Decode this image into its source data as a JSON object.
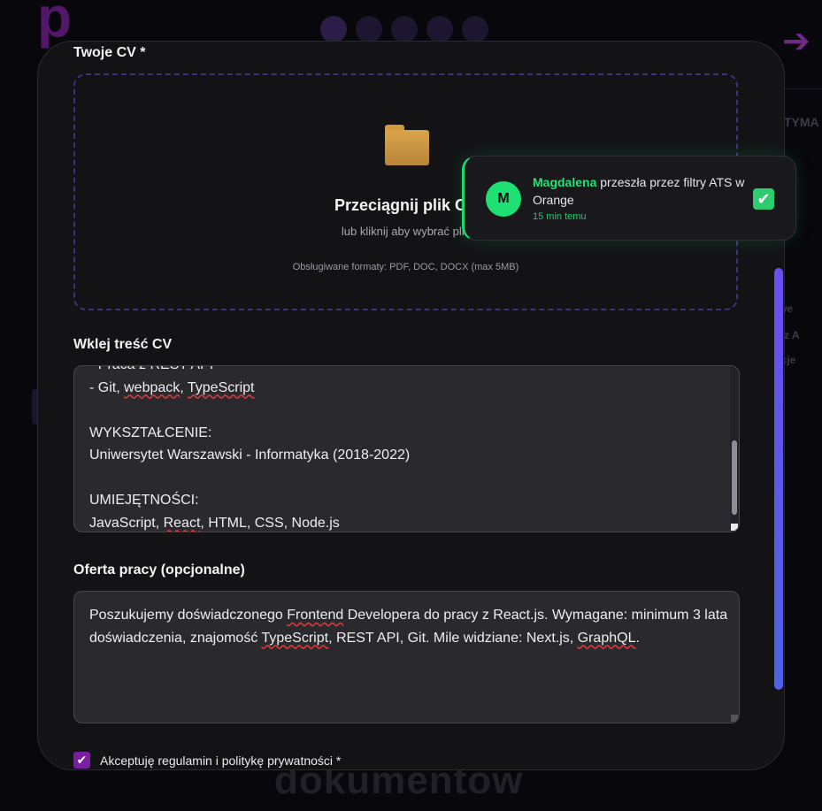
{
  "background": {
    "logo_letter": "p",
    "bottom_text": "dokumentow",
    "right_fragments": [
      "TYMA",
      "we",
      "y z A",
      "kcje"
    ]
  },
  "cv_upload": {
    "label": "Twoje CV *",
    "dropzone_title": "Przeciągnij plik CV",
    "dropzone_subtitle": "lub kliknij aby wybrać plik",
    "formats": "Obsługiwane formaty: PDF, DOC, DOCX (max 5MB)"
  },
  "paste_cv": {
    "label": "Wklej treść CV",
    "lines": [
      "- Praca z REST API",
      "- Git, webpack, TypeScript",
      "",
      "WYKSZTAŁCENIE:",
      "Uniwersytet Warszawski - Informatyka (2018-2022)",
      "",
      "UMIEJĘTNOŚCI:",
      "JavaScript, React, HTML, CSS, Node.js"
    ]
  },
  "job_offer": {
    "label": "Oferta pracy (opcjonalne)",
    "value": "Poszukujemy doświadczonego Frontend Developera do pracy z React.js. Wymagane: minimum 3 lata doświadczenia, znajomość TypeScript, REST API, Git. Mile widziane: Next.js, GraphQL."
  },
  "terms": {
    "label": "Akceptuję regulamin i politykę prywatności *",
    "checked": true
  },
  "toast": {
    "avatar_letter": "M",
    "name": "Magdalena",
    "message": "przeszła przez filtry ATS w Orange",
    "time": "15 min temu",
    "accent_color": "#1ed96b"
  },
  "colors": {
    "accent_purple": "#7a1fa2",
    "dropzone_border": "#3d3379",
    "success_green": "#1ed96b"
  }
}
